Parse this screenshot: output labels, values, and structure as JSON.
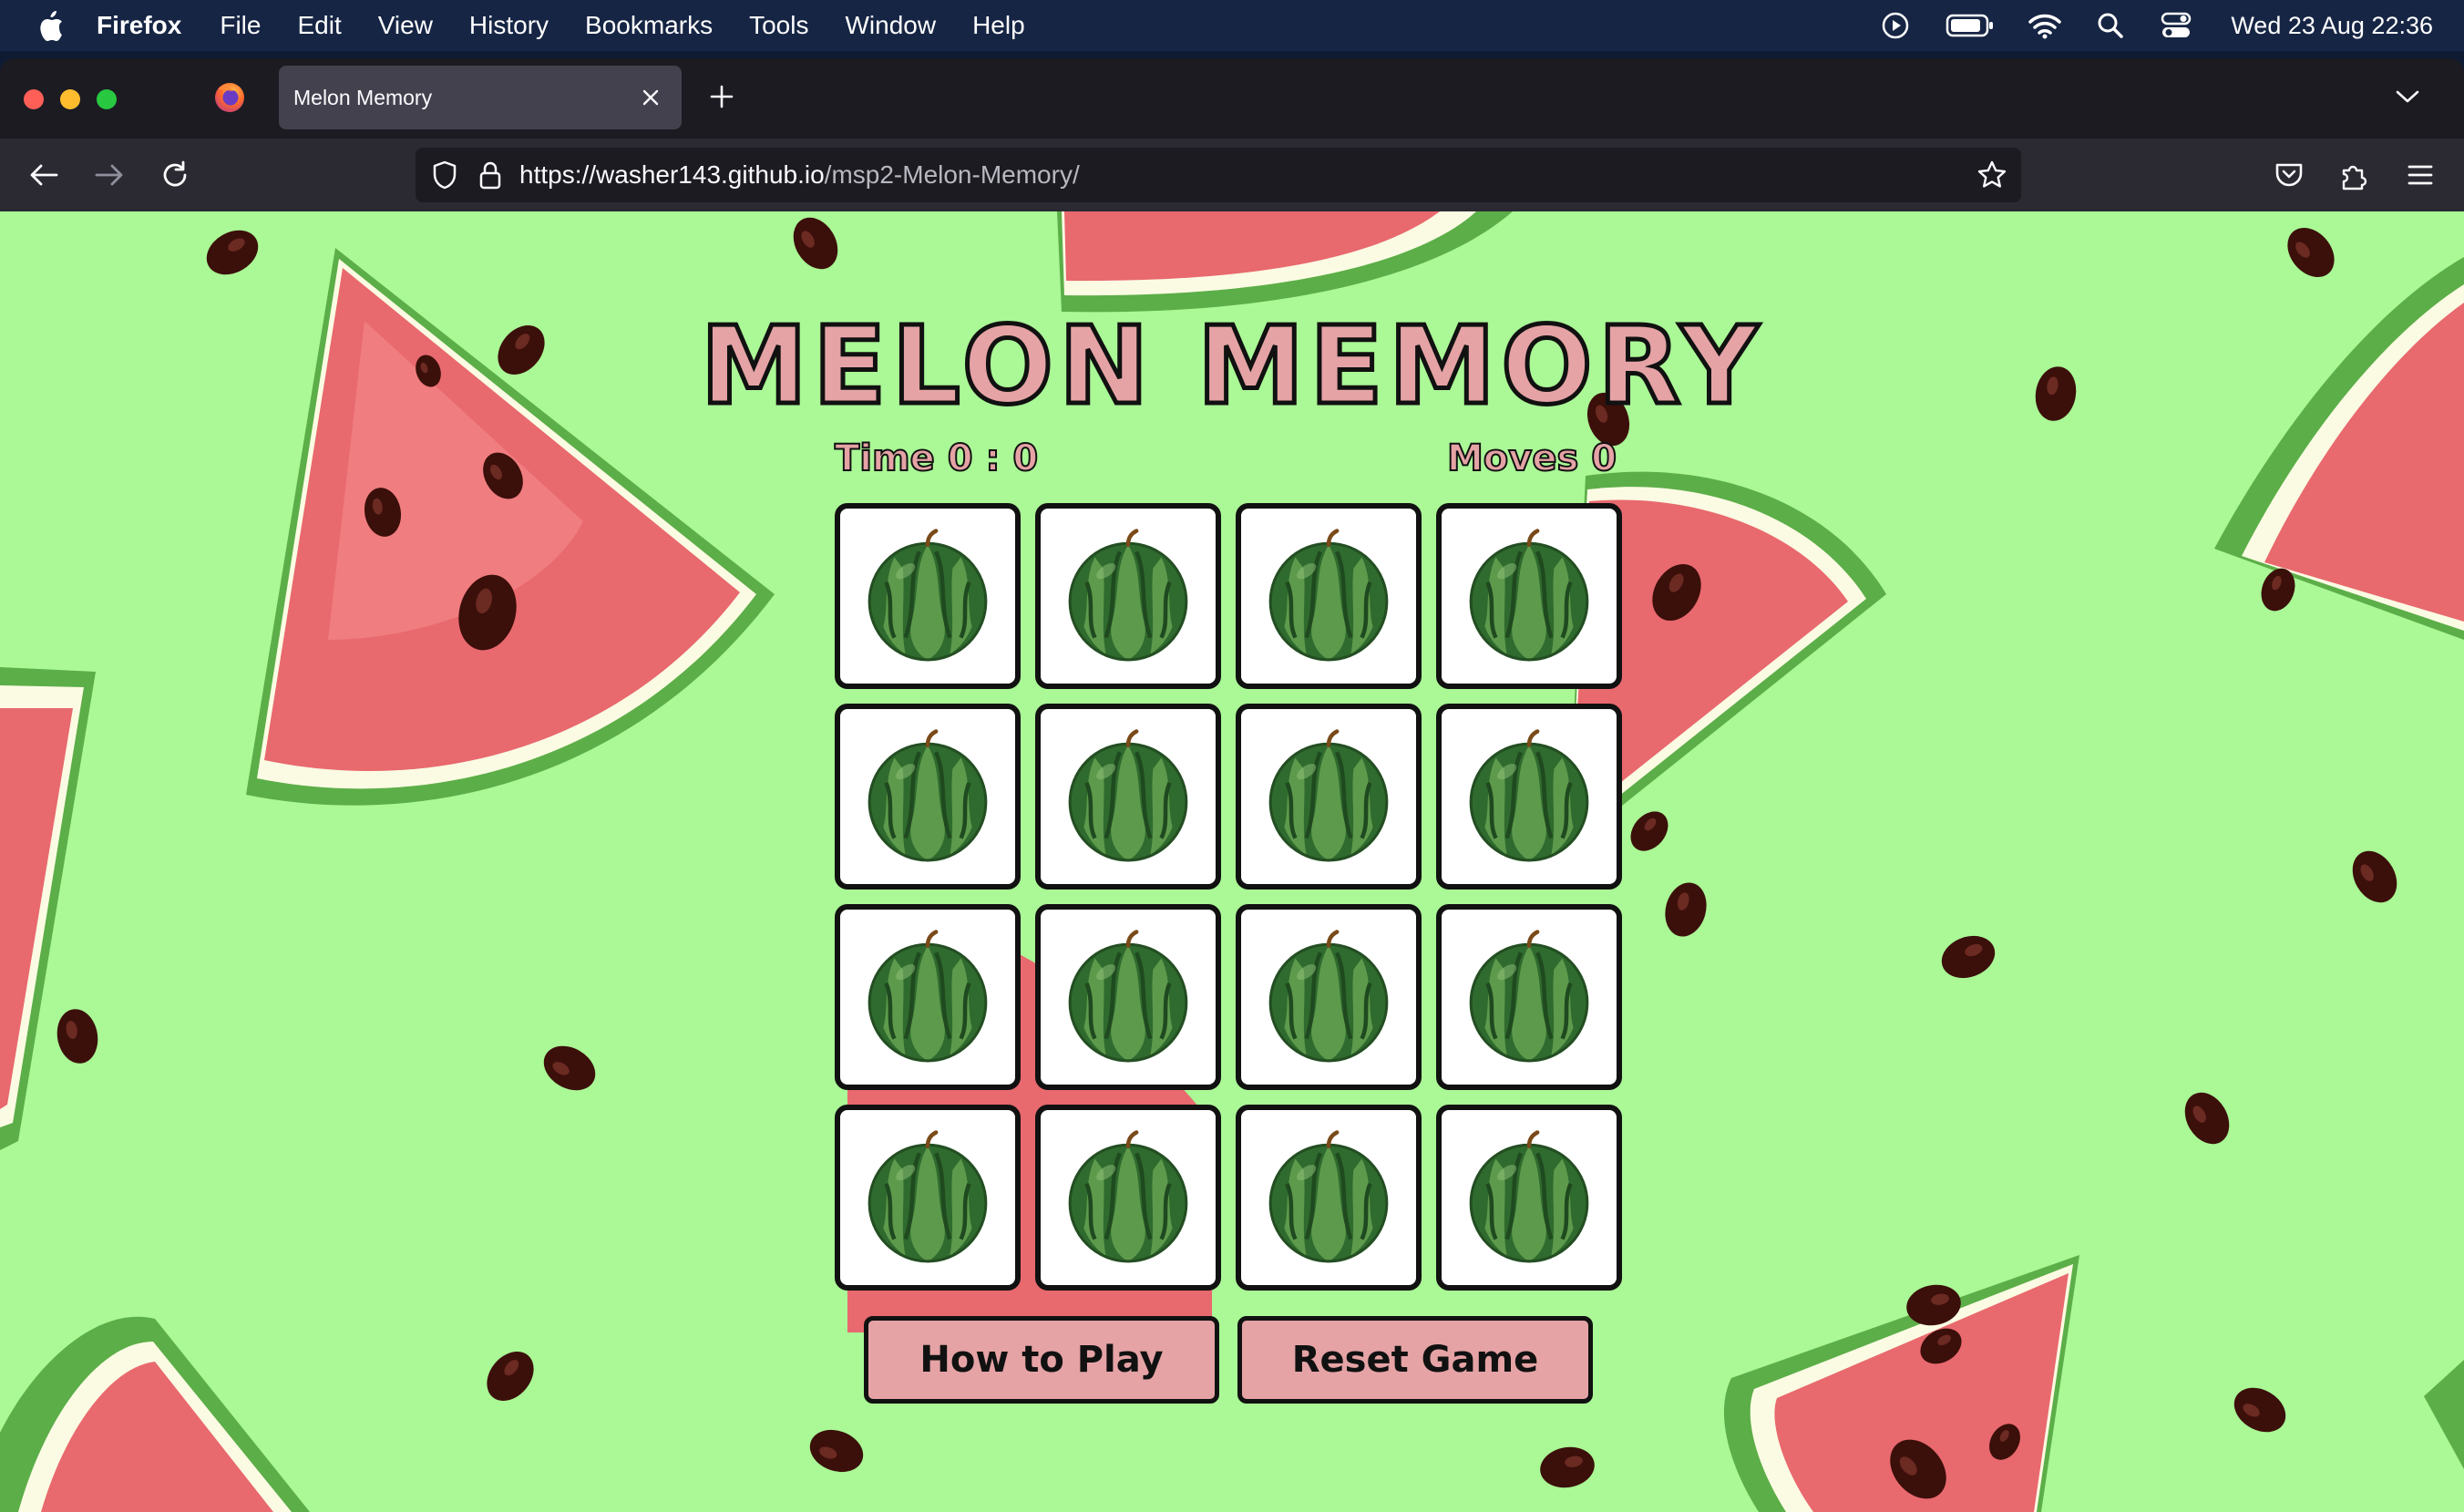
{
  "menubar": {
    "app_name": "Firefox",
    "items": [
      "File",
      "Edit",
      "View",
      "History",
      "Bookmarks",
      "Tools",
      "Window",
      "Help"
    ],
    "clock": "Wed 23 Aug  22:36"
  },
  "browser": {
    "tab_title": "Melon Memory",
    "url_host": "https://washer143.github.io",
    "url_path": "/msp2-Melon-Memory/"
  },
  "game": {
    "title": "MELON MEMORY",
    "time_label": "Time",
    "time_value": "0 : 0",
    "moves_label": "Moves",
    "moves_value": "0",
    "card_count": 16,
    "card_face": "watermelon-icon",
    "how_to_play_label": "How to Play",
    "reset_label": "Reset Game"
  },
  "colors": {
    "page_background": "#aaf896",
    "accent_pink": "#e5a3a5",
    "outline": "#111111",
    "menubar": "#162544"
  }
}
